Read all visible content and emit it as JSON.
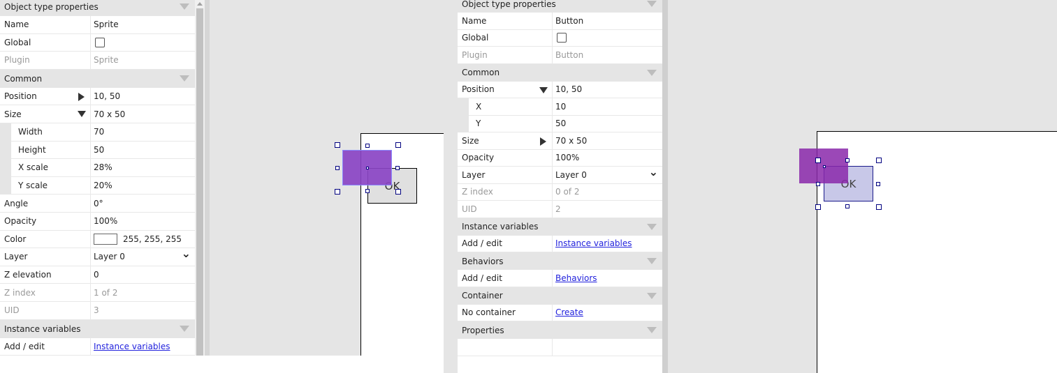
{
  "left": {
    "sections": [
      {
        "title": "Object type properties",
        "rows": [
          {
            "label": "Name",
            "value": "Sprite"
          },
          {
            "label": "Global",
            "type": "checkbox",
            "checked": false
          },
          {
            "label": "Plugin",
            "value": "Sprite",
            "disabled": true
          }
        ]
      },
      {
        "title": "Common",
        "rows": [
          {
            "label": "Position",
            "value": "10, 50",
            "expander": "closed"
          },
          {
            "label": "Size",
            "value": "70 x 50",
            "expander": "open"
          },
          {
            "label": "Width",
            "value": "70",
            "sub": true
          },
          {
            "label": "Height",
            "value": "50",
            "sub": true
          },
          {
            "label": "X scale",
            "value": "28%",
            "sub": true
          },
          {
            "label": "Y scale",
            "value": "20%",
            "sub": true
          },
          {
            "label": "Angle",
            "value": "0°"
          },
          {
            "label": "Opacity",
            "value": "100%"
          },
          {
            "label": "Color",
            "value": "255, 255, 255",
            "type": "color",
            "color": "#ffffff"
          },
          {
            "label": "Layer",
            "value": "Layer 0",
            "type": "select"
          },
          {
            "label": "Z elevation",
            "value": "0"
          },
          {
            "label": "Z index",
            "value": "1 of 2",
            "disabled": true
          },
          {
            "label": "UID",
            "value": "3",
            "disabled": true
          }
        ]
      },
      {
        "title": "Instance variables",
        "rows": [
          {
            "label": "Add / edit",
            "value": "Instance variables",
            "type": "link"
          }
        ]
      }
    ],
    "canvas": {
      "button_text": "OK"
    }
  },
  "right": {
    "sections": [
      {
        "title": "Object type properties",
        "rows": [
          {
            "label": "Name",
            "value": "Button"
          },
          {
            "label": "Global",
            "type": "checkbox",
            "checked": false
          },
          {
            "label": "Plugin",
            "value": "Button",
            "disabled": true
          }
        ]
      },
      {
        "title": "Common",
        "rows": [
          {
            "label": "Position",
            "value": "10, 50",
            "expander": "open"
          },
          {
            "label": "X",
            "value": "10",
            "sub": true
          },
          {
            "label": "Y",
            "value": "50",
            "sub": true
          },
          {
            "label": "Size",
            "value": "70 x 50",
            "expander": "closed"
          },
          {
            "label": "Opacity",
            "value": "100%"
          },
          {
            "label": "Layer",
            "value": "Layer 0",
            "type": "select"
          },
          {
            "label": "Z index",
            "value": "0 of 2",
            "disabled": true
          },
          {
            "label": "UID",
            "value": "2",
            "disabled": true
          }
        ]
      },
      {
        "title": "Instance variables",
        "rows": [
          {
            "label": "Add / edit",
            "value": "Instance variables",
            "type": "link"
          }
        ]
      },
      {
        "title": "Behaviors",
        "rows": [
          {
            "label": "Add / edit",
            "value": "Behaviors",
            "type": "link"
          }
        ]
      },
      {
        "title": "Container",
        "rows": [
          {
            "label": "No container",
            "value": "Create",
            "type": "link"
          }
        ]
      },
      {
        "title": "Properties",
        "rows": [
          {
            "label": "",
            "value": ""
          }
        ]
      }
    ],
    "canvas": {
      "button_text": "OK"
    }
  },
  "colors": {
    "sprite": "#8a44c4",
    "canvas_bg": "#e5e5e5",
    "handle": "#000080",
    "link": "#2222dd"
  }
}
